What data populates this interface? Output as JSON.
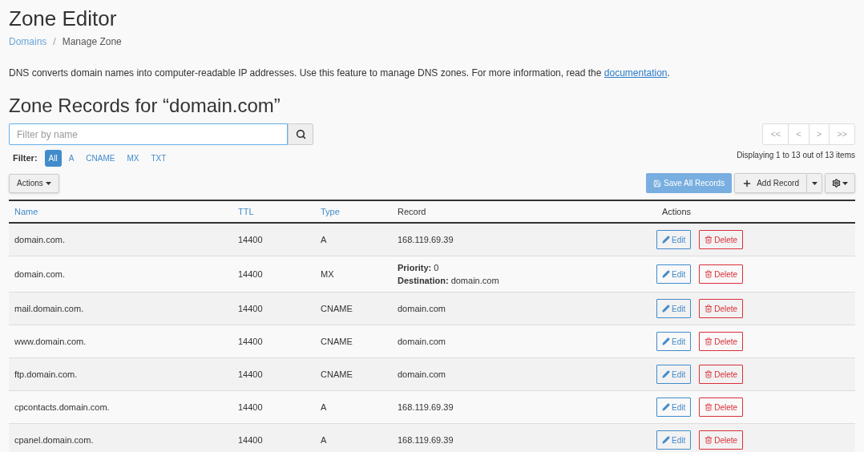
{
  "page_title": "Zone Editor",
  "breadcrumb": {
    "separator": "/",
    "items": [
      {
        "label": "Domains",
        "link": true
      },
      {
        "label": "Manage Zone",
        "link": false
      }
    ]
  },
  "description": {
    "text": "DNS converts domain names into computer-readable IP addresses. Use this feature to manage DNS zones. For more information, read the ",
    "link": "documentation",
    "end": "."
  },
  "section_title": "Zone Records for “domain.com”",
  "search": {
    "placeholder": "Filter by name"
  },
  "filter": {
    "label": "Filter:",
    "options": [
      {
        "label": "All",
        "selected": true
      },
      {
        "label": "A",
        "selected": false
      },
      {
        "label": "CNAME",
        "selected": false
      },
      {
        "label": "MX",
        "selected": false
      },
      {
        "label": "TXT",
        "selected": false
      }
    ]
  },
  "pagination": {
    "buttons": [
      "<<",
      "<",
      ">",
      ">>"
    ],
    "summary": "Displaying 1 to 13 out of 13 items"
  },
  "actions_button": "Actions",
  "save_button": "Save All Records",
  "add_button": "Add Record",
  "table": {
    "columns": [
      {
        "label": "Name",
        "sortable": true
      },
      {
        "label": "TTL",
        "sortable": true
      },
      {
        "label": "Type",
        "sortable": true
      },
      {
        "label": "Record",
        "sortable": false
      },
      {
        "label": "Actions",
        "sortable": false
      }
    ],
    "rows": [
      {
        "name": "domain.com.",
        "ttl": "14400",
        "type": "A",
        "record": {
          "kind": "plain",
          "value": "168.119.69.39"
        },
        "edit": "Edit",
        "delete": "Delete"
      },
      {
        "name": "domain.com.",
        "ttl": "14400",
        "type": "MX",
        "record": {
          "kind": "mx",
          "priority_label": "Priority:",
          "priority": "0",
          "destination_label": "Destination:",
          "destination": "domain.com"
        },
        "edit": "Edit",
        "delete": "Delete"
      },
      {
        "name": "mail.domain.com.",
        "ttl": "14400",
        "type": "CNAME",
        "record": {
          "kind": "plain",
          "value": "domain.com"
        },
        "edit": "Edit",
        "delete": "Delete"
      },
      {
        "name": "www.domain.com.",
        "ttl": "14400",
        "type": "CNAME",
        "record": {
          "kind": "plain",
          "value": "domain.com"
        },
        "edit": "Edit",
        "delete": "Delete"
      },
      {
        "name": "ftp.domain.com.",
        "ttl": "14400",
        "type": "CNAME",
        "record": {
          "kind": "plain",
          "value": "domain.com"
        },
        "edit": "Edit",
        "delete": "Delete"
      },
      {
        "name": "cpcontacts.domain.com.",
        "ttl": "14400",
        "type": "A",
        "record": {
          "kind": "plain",
          "value": "168.119.69.39"
        },
        "edit": "Edit",
        "delete": "Delete"
      },
      {
        "name": "cpanel.domain.com.",
        "ttl": "14400",
        "type": "A",
        "record": {
          "kind": "plain",
          "value": "168.119.69.39"
        },
        "edit": "Edit",
        "delete": "Delete"
      }
    ]
  }
}
